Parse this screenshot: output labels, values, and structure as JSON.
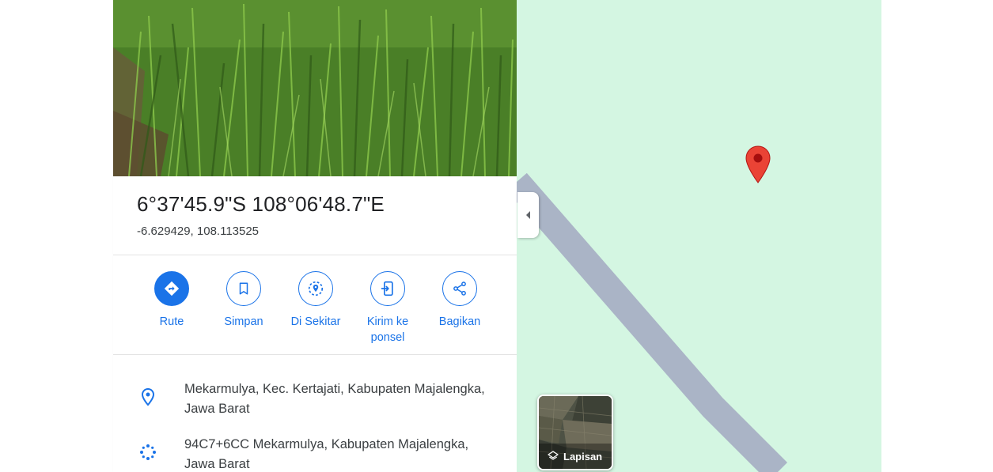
{
  "place": {
    "title": "6°37'45.9\"S 108°06'48.7\"E",
    "decimal": "-6.629429, 108.113525"
  },
  "actions": [
    {
      "label": "Rute",
      "icon": "directions-icon"
    },
    {
      "label": "Simpan",
      "icon": "bookmark-icon"
    },
    {
      "label": "Di Sekitar",
      "icon": "nearby-icon"
    },
    {
      "label": "Kirim ke ponsel",
      "icon": "send-to-phone-icon"
    },
    {
      "label": "Bagikan",
      "icon": "share-icon"
    }
  ],
  "info": {
    "address": "Mekarmulya, Kec. Kertajati, Kabupaten Majalengka, Jawa Barat",
    "plus_code": "94C7+6CC Mekarmulya, Kabupaten Majalengka, Jawa Barat"
  },
  "map": {
    "layers_label": "Lapisan",
    "background_color": "#d4f6e2",
    "road_color": "#aab4c6",
    "pin_color": "#ea4335"
  },
  "colors": {
    "accent": "#1a73e8",
    "text_primary": "#202124",
    "text_secondary": "#3c4043"
  }
}
